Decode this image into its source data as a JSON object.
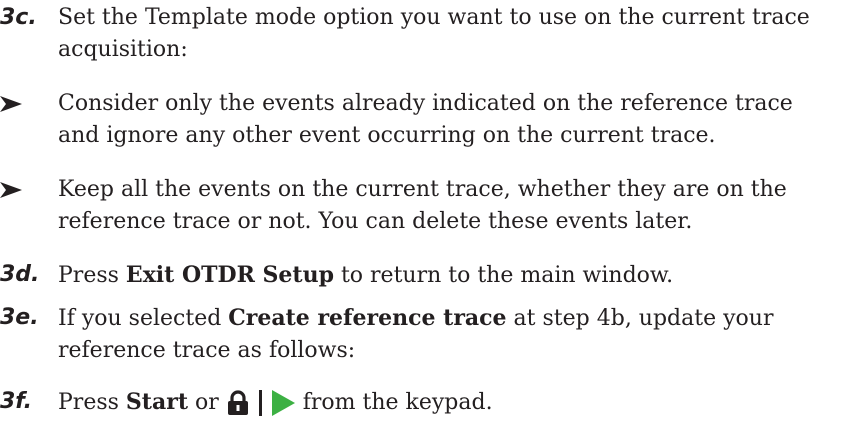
{
  "step_3c": {
    "marker": "3c.",
    "text": "Set the Template mode option you want to use on the current trace acquisition:"
  },
  "bullets": [
    {
      "text": "Consider only the events already indicated on the reference trace and ignore any other event occurring on the current trace."
    },
    {
      "text": "Keep all the events on the current trace, whether they are on the reference trace or not. You can delete these events later."
    }
  ],
  "step_3d": {
    "marker": "3d.",
    "pre": "Press ",
    "bold": "Exit OTDR Setup",
    "post": " to return to the main window."
  },
  "step_3e": {
    "marker": "3e.",
    "pre": "If you selected ",
    "bold": "Create reference trace",
    "post": " at step 4b, update your reference trace as follows:"
  },
  "step_3f": {
    "marker": "3f.",
    "pre": "Press ",
    "bold": "Start",
    "mid": " or ",
    "post": " from the keypad.",
    "icons": [
      "lock-icon",
      "separator-bar-icon",
      "play-icon"
    ],
    "play_color": "#3cb043"
  }
}
